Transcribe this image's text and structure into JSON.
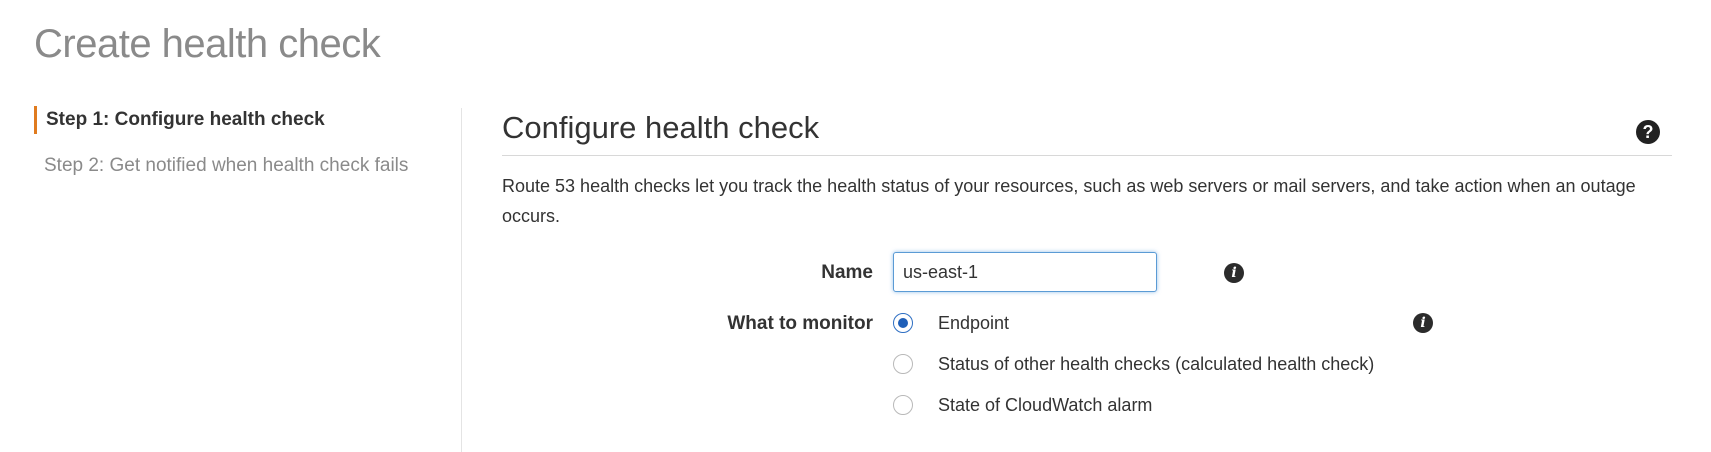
{
  "page": {
    "title": "Create health check"
  },
  "steps": [
    {
      "label": "Step 1: Configure health check",
      "active": true
    },
    {
      "label": "Step 2: Get notified when health check fails",
      "active": false
    }
  ],
  "section": {
    "title": "Configure health check",
    "help_icon": "question-circle-icon",
    "help_glyph": "?",
    "description": "Route 53 health checks let you track the health status of your resources, such as web servers or mail servers, and take action when an outage occurs."
  },
  "form": {
    "name_label": "Name",
    "name_value": "us-east-1",
    "info_icon": "info-circle-icon",
    "info_glyph": "i",
    "monitor_label": "What to monitor",
    "monitor_options": [
      {
        "label": "Endpoint",
        "selected": true
      },
      {
        "label": "Status of other health checks (calculated health check)",
        "selected": false
      },
      {
        "label": "State of CloudWatch alarm",
        "selected": false
      }
    ]
  },
  "colors": {
    "accent_step": "#e07b1f",
    "radio_selected": "#1f5fb8",
    "input_focus": "#5b9bd5"
  }
}
